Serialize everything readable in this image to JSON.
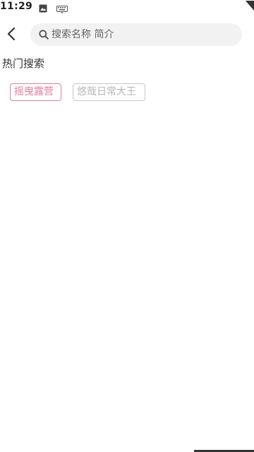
{
  "status_bar": {
    "time": "11:29",
    "icons": [
      "image-icon",
      "keyboard-icon",
      "signal-icon"
    ]
  },
  "header": {
    "back_icon": "chevron-left-icon",
    "search": {
      "icon": "search-icon",
      "placeholder": "搜索名称 简介",
      "value": ""
    }
  },
  "hot_search": {
    "title": "热门搜索",
    "tags": [
      {
        "label": "摇曳露营",
        "color": "#e0809a"
      },
      {
        "label": "悠哉日常大王",
        "color": "#b5b5b5"
      }
    ]
  }
}
